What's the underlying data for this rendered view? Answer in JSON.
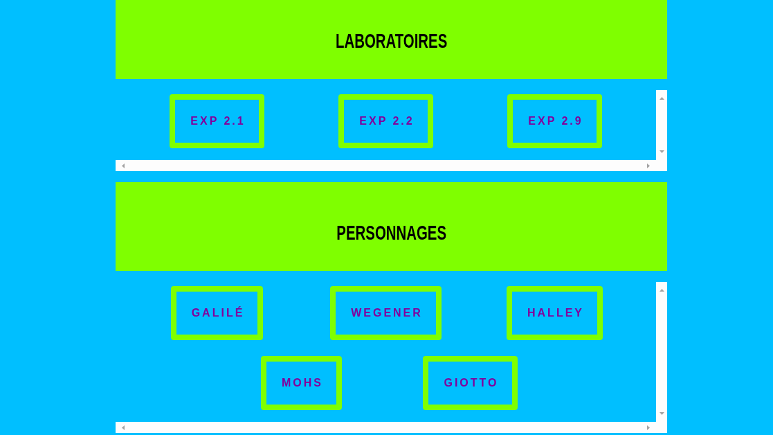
{
  "sections": [
    {
      "title": "LABORATOIRES",
      "buttons": [
        "EXP 2.1",
        "EXP 2.2",
        "EXP 2.9"
      ]
    },
    {
      "title": "PERSONNAGES",
      "buttons": [
        "GALILÉ",
        "WEGENER",
        "HALLEY",
        "MOHS",
        "GIOTTO"
      ]
    }
  ]
}
